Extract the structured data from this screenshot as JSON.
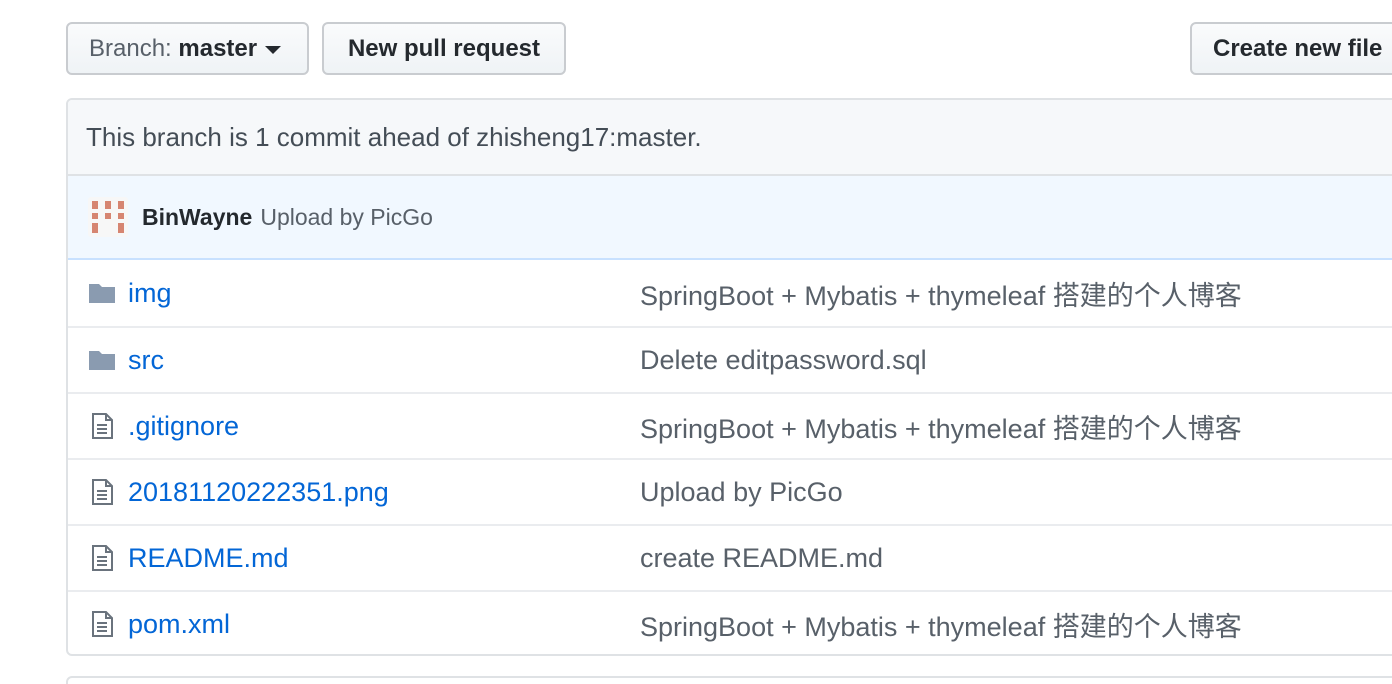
{
  "toolbar": {
    "branch_prefix": "Branch:",
    "branch_name": "master",
    "new_pull_request": "New pull request",
    "create_new_file": "Create new file"
  },
  "branch_info": {
    "text": "This branch is 1 commit ahead of zhisheng17:master."
  },
  "latest_commit": {
    "author": "BinWayne",
    "message": "Upload by PicGo"
  },
  "files": [
    {
      "type": "folder",
      "icon": "folder-icon",
      "name": "img",
      "message": "SpringBoot + Mybatis + thymeleaf 搭建的个人博客"
    },
    {
      "type": "folder",
      "icon": "folder-icon",
      "name": "src",
      "message": "Delete editpassword.sql"
    },
    {
      "type": "file",
      "icon": "file-icon",
      "name": ".gitignore",
      "message": "SpringBoot + Mybatis + thymeleaf 搭建的个人博客"
    },
    {
      "type": "file",
      "icon": "file-icon",
      "name": "20181120222351.png",
      "message": "Upload by PicGo"
    },
    {
      "type": "file",
      "icon": "file-icon",
      "name": "README.md",
      "message": "create README.md"
    },
    {
      "type": "file",
      "icon": "file-icon",
      "name": "pom.xml",
      "message": "SpringBoot + Mybatis + thymeleaf 搭建的个人博客"
    }
  ],
  "colors": {
    "link": "#0366d6",
    "muted": "#586069",
    "commit_bar_bg": "#f1f8ff",
    "folder_icon": "#79b8ff",
    "avatar_accent": "#d68571"
  }
}
